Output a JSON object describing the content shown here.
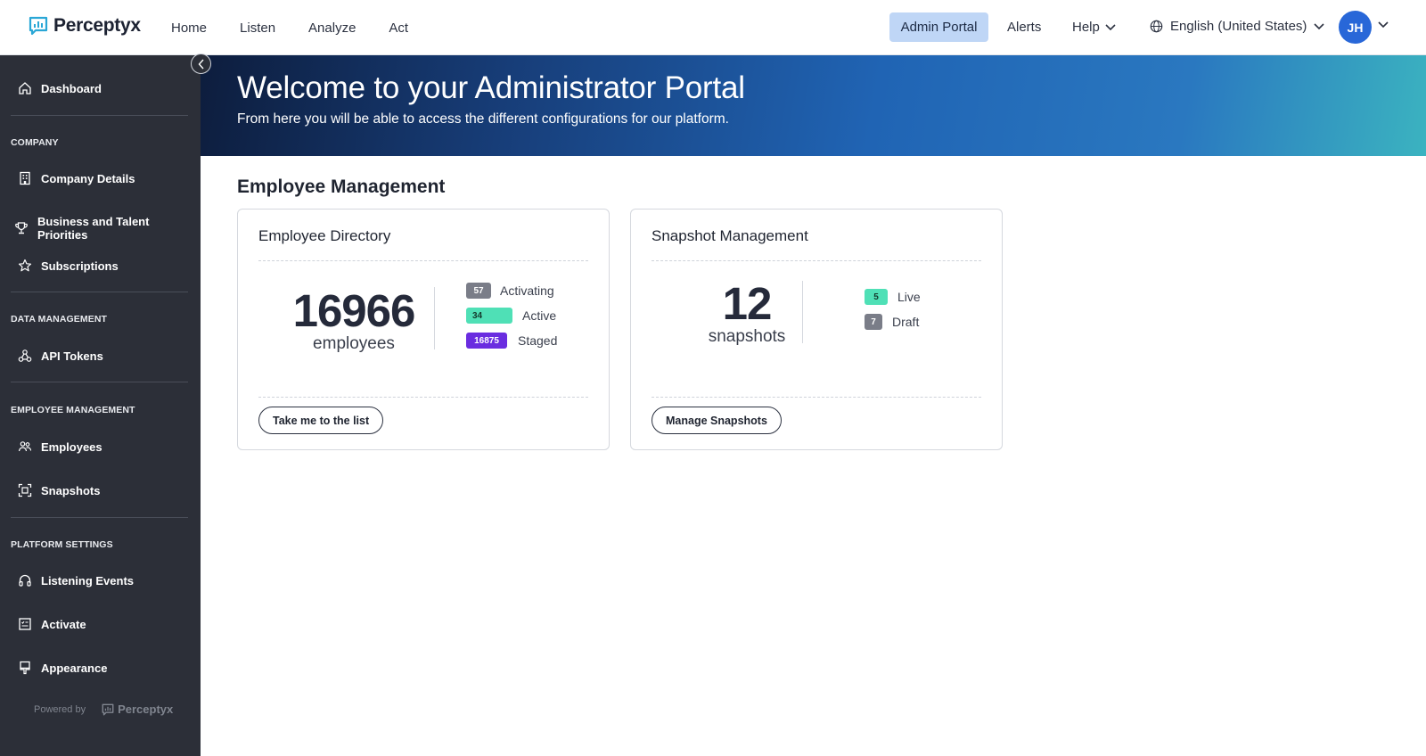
{
  "brand": {
    "name": "Perceptyx"
  },
  "nav": {
    "items": [
      "Home",
      "Listen",
      "Analyze",
      "Act"
    ],
    "admin_portal": "Admin Portal",
    "alerts": "Alerts",
    "help": "Help",
    "language": "English (United States)",
    "avatar_initials": "JH"
  },
  "sidebar": {
    "dashboard": "Dashboard",
    "sections": [
      {
        "title": "COMPANY",
        "items": [
          "Company Details",
          "Business and Talent Priorities",
          "Subscriptions"
        ]
      },
      {
        "title": "DATA MANAGEMENT",
        "items": [
          "API Tokens"
        ]
      },
      {
        "title": "EMPLOYEE MANAGEMENT",
        "items": [
          "Employees",
          "Snapshots"
        ]
      },
      {
        "title": "PLATFORM SETTINGS",
        "items": [
          "Listening Events",
          "Activate",
          "Appearance"
        ]
      }
    ],
    "powered_by": "Powered by",
    "powered_brand": "Perceptyx"
  },
  "banner": {
    "title": "Welcome to your Administrator Portal",
    "subtitle": "From here you will be able to access the different configurations for our platform."
  },
  "main": {
    "section_title": "Employee Management",
    "employee_directory": {
      "title": "Employee Directory",
      "count": "16966",
      "count_label": "employees",
      "stats": [
        {
          "value": "57",
          "label": "Activating",
          "color": "#7a7d88"
        },
        {
          "value": "34",
          "label": "Active",
          "color": "#4fe0b6"
        },
        {
          "value": "16875",
          "label": "Staged",
          "color": "#6a2de0"
        }
      ],
      "button": "Take me to the list"
    },
    "snapshot_management": {
      "title": "Snapshot Management",
      "count": "12",
      "count_label": "snapshots",
      "stats": [
        {
          "value": "5",
          "label": "Live",
          "color": "#4fe0b6"
        },
        {
          "value": "7",
          "label": "Draft",
          "color": "#7a7d88"
        }
      ],
      "button": "Manage Snapshots"
    }
  },
  "colors": {
    "sidebar_bg": "#2c2f38",
    "admin_btn_bg": "#bfd6f6",
    "avatar_bg": "#2867d8",
    "brand_icon": "#2aa7d6"
  }
}
